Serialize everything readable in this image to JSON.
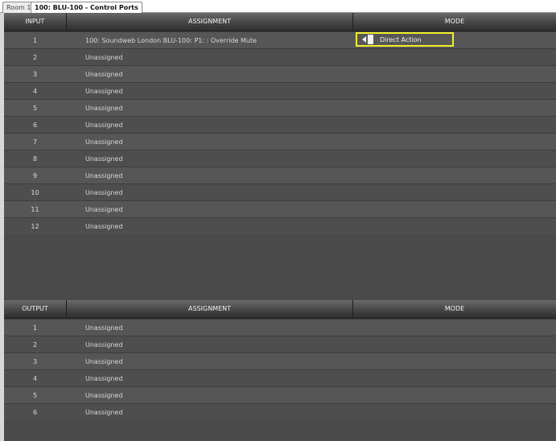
{
  "tabs": [
    {
      "label": "Room 1"
    },
    {
      "label": "100: BLU-100 - Control Ports"
    }
  ],
  "input_table": {
    "headers": {
      "num": "INPUT",
      "assignment": "ASSIGNMENT",
      "mode": "MODE"
    },
    "rows": [
      {
        "num": "1",
        "assignment": "100: Soundweb London BLU-100: P1: : Override Mute",
        "mode": "Direct Action",
        "mode_icon": "direct-action-icon"
      },
      {
        "num": "2",
        "assignment": "Unassigned",
        "mode": ""
      },
      {
        "num": "3",
        "assignment": "Unassigned",
        "mode": ""
      },
      {
        "num": "4",
        "assignment": "Unassigned",
        "mode": ""
      },
      {
        "num": "5",
        "assignment": "Unassigned",
        "mode": ""
      },
      {
        "num": "6",
        "assignment": "Unassigned",
        "mode": ""
      },
      {
        "num": "7",
        "assignment": "Unassigned",
        "mode": ""
      },
      {
        "num": "8",
        "assignment": "Unassigned",
        "mode": ""
      },
      {
        "num": "9",
        "assignment": "Unassigned",
        "mode": ""
      },
      {
        "num": "10",
        "assignment": "Unassigned",
        "mode": ""
      },
      {
        "num": "11",
        "assignment": "Unassigned",
        "mode": ""
      },
      {
        "num": "12",
        "assignment": "Unassigned",
        "mode": ""
      }
    ]
  },
  "output_table": {
    "headers": {
      "num": "OUTPUT",
      "assignment": "ASSIGNMENT",
      "mode": "MODE"
    },
    "rows": [
      {
        "num": "1",
        "assignment": "Unassigned",
        "mode": ""
      },
      {
        "num": "2",
        "assignment": "Unassigned",
        "mode": ""
      },
      {
        "num": "3",
        "assignment": "Unassigned",
        "mode": ""
      },
      {
        "num": "4",
        "assignment": "Unassigned",
        "mode": ""
      },
      {
        "num": "5",
        "assignment": "Unassigned",
        "mode": ""
      },
      {
        "num": "6",
        "assignment": "Unassigned",
        "mode": ""
      }
    ]
  },
  "colors": {
    "highlight": "#f2ee2a",
    "panel_bg": "#4a4a4a",
    "header_bg": "#454545"
  }
}
